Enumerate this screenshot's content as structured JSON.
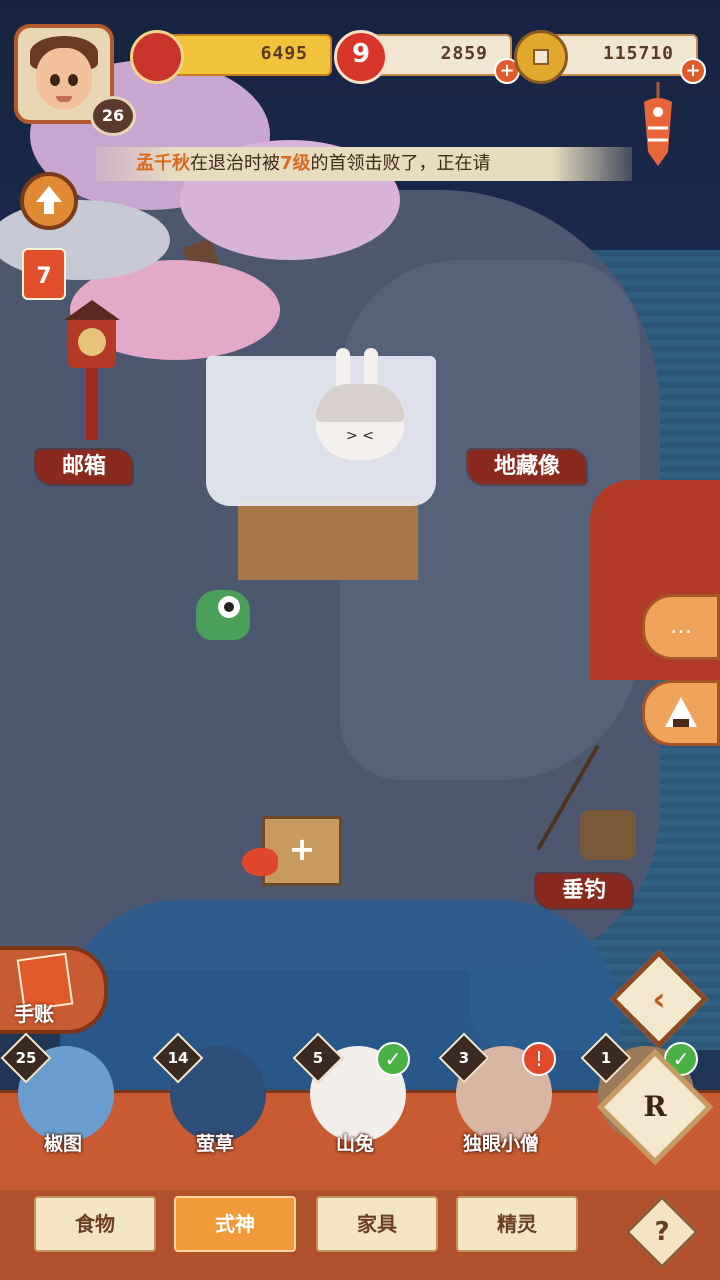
{
  "player": {
    "level": "26"
  },
  "resources": {
    "gold": "6495",
    "gems": "2859",
    "coins": "115710"
  },
  "notice": {
    "name": "孟千秋",
    "mid1": "在退治时被",
    "level": "7级",
    "mid2": "的首领击败了，正在请"
  },
  "calendar": {
    "day": "7"
  },
  "places": {
    "mailbox": "邮箱",
    "jizo": "地藏像",
    "fishing": "垂钓"
  },
  "journal": {
    "label": "手账"
  },
  "characters": [
    {
      "count": "25",
      "name": "椒图",
      "checked": false
    },
    {
      "count": "14",
      "name": "萤草",
      "checked": false
    },
    {
      "count": "5",
      "name": "山兔",
      "checked": true
    },
    {
      "count": "3",
      "name": "独眼小僧",
      "checked": false
    },
    {
      "count": "1",
      "name": "",
      "checked": true
    }
  ],
  "tabs": [
    {
      "label": "食物",
      "active": false
    },
    {
      "label": "式神",
      "active": true
    },
    {
      "label": "家具",
      "active": false
    },
    {
      "label": "精灵",
      "active": false
    }
  ],
  "buttons": {
    "help": "?",
    "r": "R",
    "back": "‹",
    "chat": "…",
    "add": "+"
  }
}
